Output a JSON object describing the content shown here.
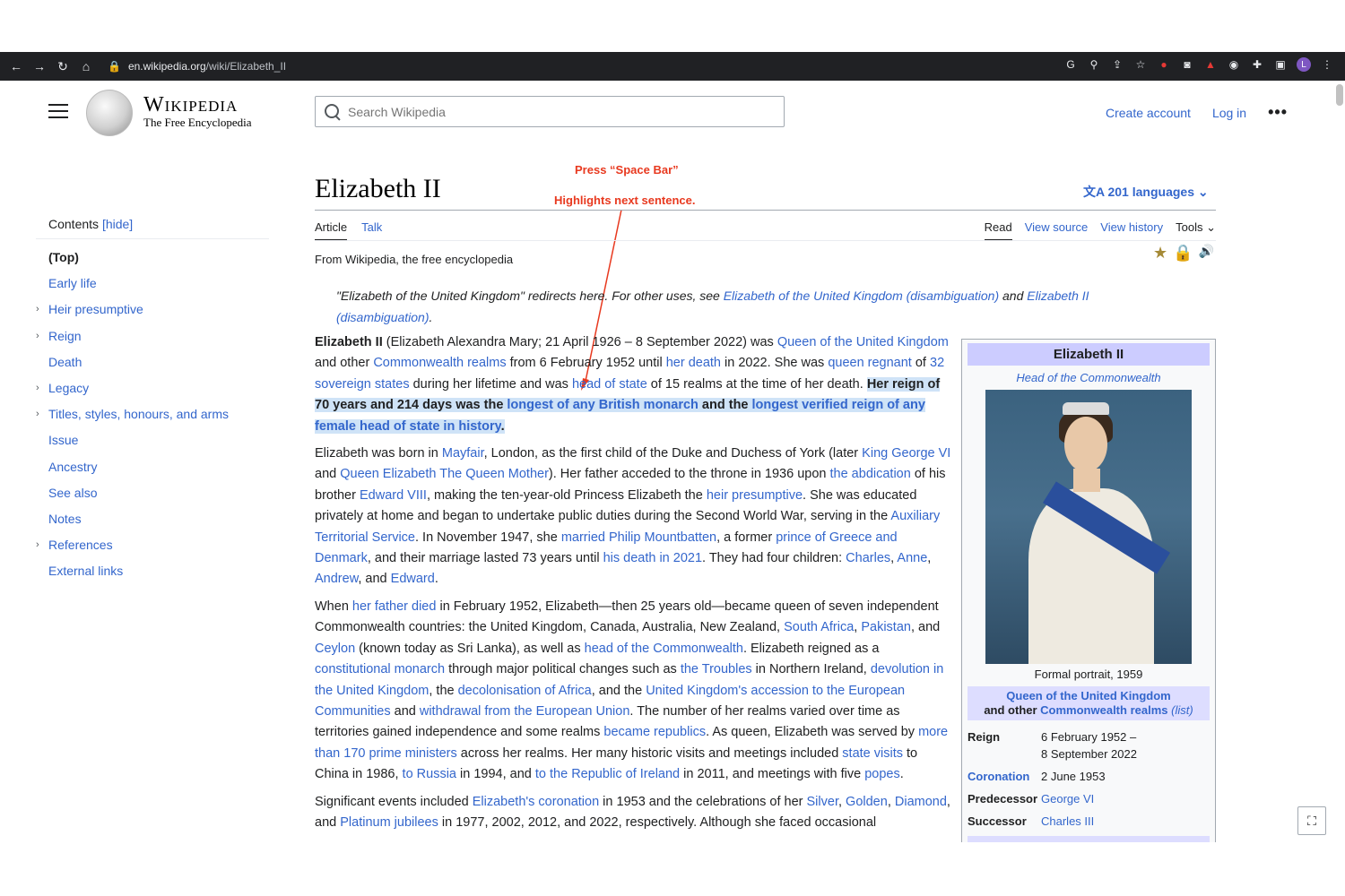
{
  "browser": {
    "url_host": "en.wikipedia.org",
    "url_path": "/wiki/Elizabeth_II"
  },
  "header": {
    "wordmark_title": "Wikipedia",
    "wordmark_tagline": "The Free Encyclopedia",
    "search_placeholder": "Search Wikipedia",
    "create_account": "Create account",
    "log_in": "Log in",
    "more": "•••"
  },
  "annotations": {
    "line1": "Press “Space Bar”",
    "line2": "Highlights next sentence."
  },
  "article": {
    "title": "Elizabeth II",
    "languages": "201 languages",
    "tabs_left": [
      "Article",
      "Talk"
    ],
    "tabs_right": [
      "Read",
      "View source",
      "View history",
      "Tools"
    ],
    "tagline": "From Wikipedia, the free encyclopedia",
    "hatnote_pre": "\"Elizabeth of the United Kingdom\" redirects here. For other uses, see ",
    "hatnote_link1": "Elizabeth of the United Kingdom (disambiguation)",
    "hatnote_mid": " and ",
    "hatnote_link2": "Elizabeth II (disambiguation)",
    "hatnote_end": "."
  },
  "toc": {
    "head": "Contents",
    "hide": "[hide]",
    "items": [
      {
        "label": "(Top)",
        "chevron": false
      },
      {
        "label": "Early life",
        "chevron": false
      },
      {
        "label": "Heir presumptive",
        "chevron": true
      },
      {
        "label": "Reign",
        "chevron": true
      },
      {
        "label": "Death",
        "chevron": false
      },
      {
        "label": "Legacy",
        "chevron": true
      },
      {
        "label": "Titles, styles, honours, and arms",
        "chevron": true
      },
      {
        "label": "Issue",
        "chevron": false
      },
      {
        "label": "Ancestry",
        "chevron": false
      },
      {
        "label": "See also",
        "chevron": false
      },
      {
        "label": "Notes",
        "chevron": false
      },
      {
        "label": "References",
        "chevron": true
      },
      {
        "label": "External links",
        "chevron": false
      }
    ]
  },
  "body": {
    "p1": [
      {
        "t": "Elizabeth II",
        "b": true
      },
      {
        "t": " (Elizabeth Alexandra Mary; 21 April 1926 – 8 September 2022) was "
      },
      {
        "t": "Queen of the United Kingdom",
        "l": true
      },
      {
        "t": " and other "
      },
      {
        "t": "Commonwealth realms",
        "l": true
      },
      {
        "t": " from 6 February 1952 until "
      },
      {
        "t": "her death",
        "l": true
      },
      {
        "t": " in 2022. She was "
      },
      {
        "t": "queen regnant",
        "l": true
      },
      {
        "t": " of "
      },
      {
        "t": "32 sovereign states",
        "l": true
      },
      {
        "t": " during her lifetime and was "
      },
      {
        "t": "head of state",
        "l": true
      },
      {
        "t": " of 15 realms at the time of her death. "
      },
      {
        "t": "Her reign of 70 years and 214 days was the ",
        "b": true,
        "h": true
      },
      {
        "t": "longest of any British monarch",
        "b": true,
        "h": true,
        "l": true
      },
      {
        "t": " and the ",
        "b": true,
        "h": true
      },
      {
        "t": "longest verified reign of any female head of state in history",
        "b": true,
        "h": true,
        "l": true
      },
      {
        "t": ".",
        "b": true,
        "h": true
      }
    ],
    "p2": [
      {
        "t": "Elizabeth was born in "
      },
      {
        "t": "Mayfair",
        "l": true
      },
      {
        "t": ", London, as the first child of the Duke and Duchess of York (later "
      },
      {
        "t": "King George VI",
        "l": true
      },
      {
        "t": " and "
      },
      {
        "t": "Queen Elizabeth The Queen Mother",
        "l": true
      },
      {
        "t": "). Her father acceded to the throne in 1936 upon "
      },
      {
        "t": "the abdication",
        "l": true
      },
      {
        "t": " of his brother "
      },
      {
        "t": "Edward VIII",
        "l": true
      },
      {
        "t": ", making the ten-year-old Princess Elizabeth the "
      },
      {
        "t": "heir presumptive",
        "l": true
      },
      {
        "t": ". She was educated privately at home and began to undertake public duties during the Second World War, serving in the "
      },
      {
        "t": "Auxiliary Territorial Service",
        "l": true
      },
      {
        "t": ". In November 1947, she "
      },
      {
        "t": "married Philip Mountbatten",
        "l": true
      },
      {
        "t": ", a former "
      },
      {
        "t": "prince of Greece and Denmark",
        "l": true
      },
      {
        "t": ", and their marriage lasted 73 years until "
      },
      {
        "t": "his death in 2021",
        "l": true
      },
      {
        "t": ". They had four children: "
      },
      {
        "t": "Charles",
        "l": true
      },
      {
        "t": ", "
      },
      {
        "t": "Anne",
        "l": true
      },
      {
        "t": ", "
      },
      {
        "t": "Andrew",
        "l": true
      },
      {
        "t": ", and "
      },
      {
        "t": "Edward",
        "l": true
      },
      {
        "t": "."
      }
    ],
    "p3": [
      {
        "t": "When "
      },
      {
        "t": "her father died",
        "l": true
      },
      {
        "t": " in February 1952, Elizabeth—then 25 years old—became queen of seven independent Commonwealth countries: the United Kingdom, Canada, Australia, New Zealand, "
      },
      {
        "t": "South Africa",
        "l": true
      },
      {
        "t": ", "
      },
      {
        "t": "Pakistan",
        "l": true
      },
      {
        "t": ", and "
      },
      {
        "t": "Ceylon",
        "l": true
      },
      {
        "t": " (known today as Sri Lanka), as well as "
      },
      {
        "t": "head of the Commonwealth",
        "l": true
      },
      {
        "t": ". Elizabeth reigned as a "
      },
      {
        "t": "constitutional monarch",
        "l": true
      },
      {
        "t": " through major political changes such as "
      },
      {
        "t": "the Troubles",
        "l": true
      },
      {
        "t": " in Northern Ireland, "
      },
      {
        "t": "devolution in the United Kingdom",
        "l": true
      },
      {
        "t": ", the "
      },
      {
        "t": "decolonisation of Africa",
        "l": true
      },
      {
        "t": ", and the "
      },
      {
        "t": "United Kingdom's accession to the European Communities",
        "l": true
      },
      {
        "t": " and "
      },
      {
        "t": "withdrawal from the European Union",
        "l": true
      },
      {
        "t": ". The number of her realms varied over time as territories gained independence and some realms "
      },
      {
        "t": "became republics",
        "l": true
      },
      {
        "t": ". As queen, Elizabeth was served by "
      },
      {
        "t": "more than 170 prime ministers",
        "l": true
      },
      {
        "t": " across her realms. Her many historic visits and meetings included "
      },
      {
        "t": "state visits",
        "l": true
      },
      {
        "t": " to China in 1986, "
      },
      {
        "t": "to Russia",
        "l": true
      },
      {
        "t": " in 1994, and "
      },
      {
        "t": "to the Republic of Ireland",
        "l": true
      },
      {
        "t": " in 2011, and meetings with five "
      },
      {
        "t": "popes",
        "l": true
      },
      {
        "t": "."
      }
    ],
    "p4": [
      {
        "t": "Significant events included "
      },
      {
        "t": "Elizabeth's coronation",
        "l": true
      },
      {
        "t": " in 1953 and the celebrations of her "
      },
      {
        "t": "Silver",
        "l": true
      },
      {
        "t": ", "
      },
      {
        "t": "Golden",
        "l": true
      },
      {
        "t": ", "
      },
      {
        "t": "Diamond",
        "l": true
      },
      {
        "t": ", and "
      },
      {
        "t": "Platinum jubilees",
        "l": true
      },
      {
        "t": " in 1977, 2002, 2012, and 2022, respectively. Although she faced occasional"
      }
    ]
  },
  "infobox": {
    "title": "Elizabeth II",
    "subtitle": "Head of the Commonwealth",
    "caption": "Formal portrait, 1959",
    "band_link": "Queen of the United Kingdom",
    "band_and": "and other ",
    "band_link2": "Commonwealth realms",
    "band_list": "(list)",
    "rows": [
      {
        "label": "Reign",
        "value": "6 February 1952 –",
        "value2": "8 September 2022",
        "link_label": false,
        "link_value": false
      },
      {
        "label": "Coronation",
        "value": "2 June 1953",
        "link_label": true,
        "link_value": false
      },
      {
        "label": "Predecessor",
        "value": "George VI",
        "link_label": false,
        "link_value": true
      },
      {
        "label": "Successor",
        "value": "Charles III",
        "link_label": false,
        "link_value": true
      }
    ]
  }
}
